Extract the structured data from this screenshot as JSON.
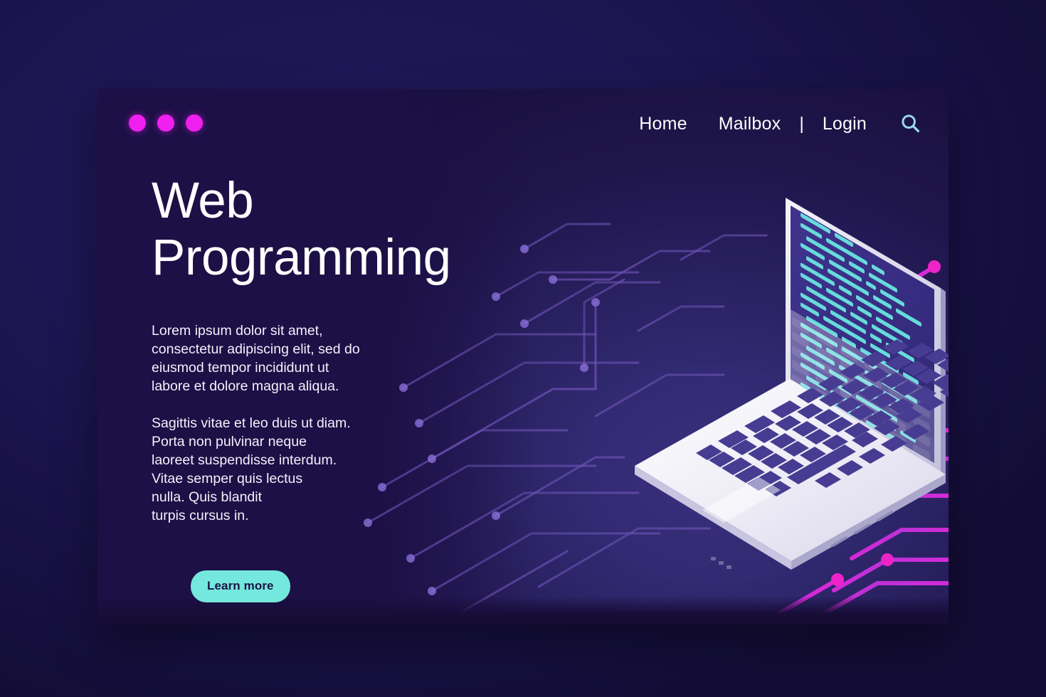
{
  "page": {
    "title": "Web Programming",
    "background_outer": "#1a1348",
    "background_card": "#281f5e",
    "accent_magenta": "#ef1ff0",
    "accent_cyan": "#74e8dc",
    "accent_search": "#9ad7ef"
  },
  "header": {
    "logo": {
      "name": "three-dots-logo",
      "dot_count": 3,
      "color": "#ef1ff0"
    },
    "nav": [
      {
        "label": "Home",
        "name": "nav-link-home"
      },
      {
        "label": "Mailbox",
        "name": "nav-link-mailbox"
      },
      {
        "label": "|",
        "name": "nav-separator"
      },
      {
        "label": "Login",
        "name": "nav-link-login"
      }
    ],
    "search": {
      "icon": "search-icon",
      "color": "#9ad7ef"
    }
  },
  "hero": {
    "heading_line_1": "Web",
    "heading_line_2": "Programming",
    "paragraph_1": "Lorem ipsum dolor sit amet,\nconsectetur adipiscing elit, sed do\neiusmod tempor incididunt ut\nlabore et dolore magna aliqua.",
    "paragraph_2": "Sagittis vitae et leo duis ut diam.\nPorta non pulvinar neque\nlaoreet suspendisse interdum.\nVitae semper quis lectus\nnulla. Quis blandit\nturpis cursus in.",
    "cta_label": "Learn more"
  },
  "illustration": {
    "name": "isometric-laptop-illustration",
    "screen_content": "code-lines",
    "code_line_color": "#66dbdb",
    "screen_color": "#3b3086",
    "body_color": "#e8e7f2",
    "key_color": "#473c92",
    "circuit_left_color": "#5a4aa0",
    "circuit_right_color": "#d62ad6",
    "node_count_left": 14,
    "node_count_right": 8
  }
}
